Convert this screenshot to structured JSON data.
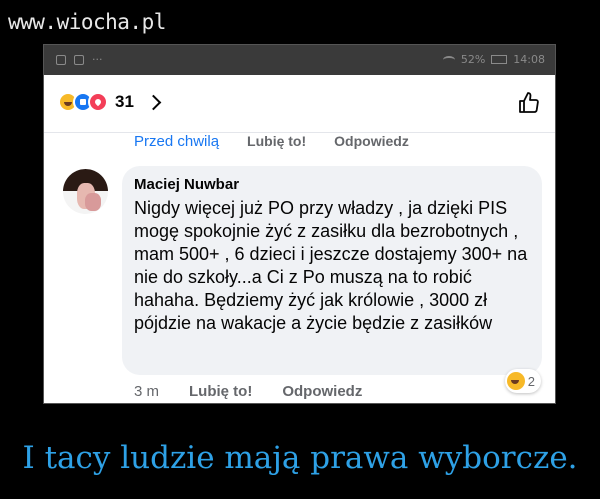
{
  "site": {
    "watermark": "www.wiocha.pl"
  },
  "statusbar": {
    "battery": "52%",
    "time": "14:08"
  },
  "post": {
    "reaction_count": "31",
    "reaction_icons": [
      "haha-reaction-icon",
      "like-reaction-icon",
      "love-reaction-icon"
    ],
    "like_icon": "thumbs-up-outline-icon"
  },
  "prev_comment": {
    "time": "Przed chwilą",
    "like_label": "Lubię to!",
    "reply_label": "Odpowiedz"
  },
  "comment": {
    "author": "Maciej Nuwbar",
    "text": "Nigdy więcej już PO przy władzy , ja dzięki PIS mogę spokojnie żyć z zasiłku dla bezrobotnych , mam 500+ , 6 dzieci i jeszcze dostajemy 300+ na nie do szkoły...a Ci z Po muszą na to robić hahaha. Będziemy żyć jak królowie , 3000 zł pójdzie na wakacje a życie będzie z zasiłków",
    "time": "3 m",
    "like_label": "Lubię to!",
    "reply_label": "Odpowiedz",
    "reaction_icon": "haha-reaction-icon",
    "reaction_count": "2"
  },
  "caption": "I tacy ludzie mają prawa wyborcze.",
  "colors": {
    "facebook_blue": "#1877f2",
    "caption": "#2ea1e6",
    "bubble_bg": "#f0f2f5",
    "secondary_text": "#65676b"
  }
}
